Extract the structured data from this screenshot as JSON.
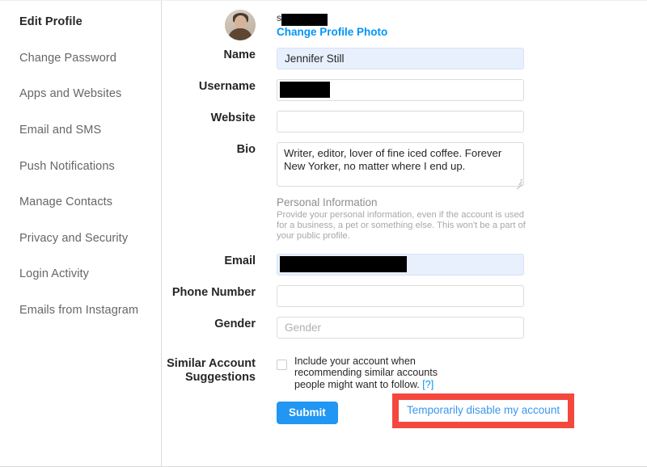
{
  "sidebar": {
    "items": [
      {
        "label": "Edit Profile",
        "active": true
      },
      {
        "label": "Change Password",
        "active": false
      },
      {
        "label": "Apps and Websites",
        "active": false
      },
      {
        "label": "Email and SMS",
        "active": false
      },
      {
        "label": "Push Notifications",
        "active": false
      },
      {
        "label": "Manage Contacts",
        "active": false
      },
      {
        "label": "Privacy and Security",
        "active": false
      },
      {
        "label": "Login Activity",
        "active": false
      },
      {
        "label": "Emails from Instagram",
        "active": false
      }
    ]
  },
  "profile_header": {
    "username_prefix": "s",
    "username_redacted": true,
    "change_photo_label": "Change Profile Photo",
    "avatar_icon": "user-photo-avatar"
  },
  "form": {
    "name": {
      "label": "Name",
      "value": "Jennifer Still",
      "placeholder": "Name",
      "autofilled": true
    },
    "username": {
      "label": "Username",
      "value": "",
      "placeholder": "Username",
      "redacted": true
    },
    "website": {
      "label": "Website",
      "value": "",
      "placeholder": ""
    },
    "bio": {
      "label": "Bio",
      "value": "Writer, editor, lover of fine iced coffee. Forever New Yorker, no matter where I end up.",
      "placeholder": "Bio"
    },
    "personal_information": {
      "title": "Personal Information",
      "description": "Provide your personal information, even if the account is used for a business, a pet or something else. This won't be a part of your public profile."
    },
    "email": {
      "label": "Email",
      "value": "",
      "placeholder": "Email",
      "autofilled": true,
      "redacted": true
    },
    "phone": {
      "label": "Phone Number",
      "value": "",
      "placeholder": ""
    },
    "gender": {
      "label": "Gender",
      "value": "",
      "placeholder": "Gender"
    },
    "similar_accounts": {
      "label": "Similar Account Suggestions",
      "label_line1": "Similar Account",
      "label_line2": "Suggestions",
      "checkbox_checked": false,
      "description": "Include your account when recommending similar accounts people might want to follow.",
      "help_label": "[?]"
    }
  },
  "actions": {
    "submit_label": "Submit",
    "disable_account_label": "Temporarily disable my account"
  },
  "colors": {
    "link_blue": "#0095f6",
    "submit_blue": "#2196f3",
    "highlight_red": "#f4483f",
    "autofill_blue": "#e8f0fe",
    "border_gray": "#dbdbdb",
    "text_dark": "#262626",
    "text_muted": "#8e8e8e"
  }
}
